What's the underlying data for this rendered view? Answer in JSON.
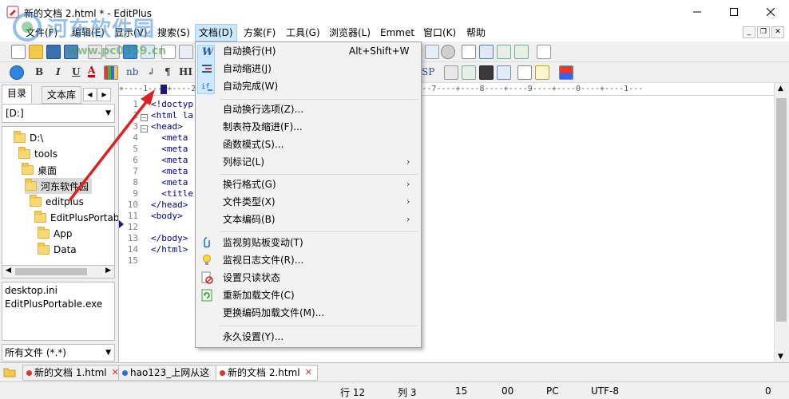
{
  "window": {
    "title": "新的文档 2.html * - EditPlus"
  },
  "menubar": {
    "items": [
      "文件(F)",
      "编辑(E)",
      "显示(V)",
      "搜索(S)",
      "文档(D)",
      "方案(F)",
      "工具(G)",
      "浏览器(L)",
      "Emmet",
      "窗口(K)",
      "帮助"
    ],
    "active": "文档(D)"
  },
  "toolbar2": {
    "bold": "B",
    "italic": "I",
    "underline": "U",
    "color_a": "A",
    "nbsp": "nb",
    "para": "¶",
    "hi": "HI",
    "sp": "SP"
  },
  "sidebar": {
    "tabs": [
      "目录",
      "文本库"
    ],
    "drive": "[D:]",
    "tree": [
      "D:\\",
      "tools",
      "桌面",
      "河东软件园",
      "editplus",
      "EditPlusPortable",
      "App",
      "Data"
    ],
    "selected_tree_item": "河东软件园",
    "files": [
      "desktop.ini",
      "EditPlusPortable.exe"
    ],
    "filter": "所有文件 (*.*)"
  },
  "editor": {
    "ruler": "+----1----+----2----+----3----+----4----+----5----+----6----+----7----+----8----+----9----+----0----+----1---",
    "line_numbers": [
      "1",
      "2",
      "3",
      "4",
      "5",
      "6",
      "7",
      "8",
      "9",
      "10",
      "11",
      "12",
      "13",
      "14",
      "15"
    ],
    "code_lines": [
      "<!doctyp",
      "<html la",
      "<head>",
      "  <meta",
      "  <meta",
      "  <meta",
      "  <meta",
      "  <meta",
      "  <title",
      "</head>",
      "<body>",
      "",
      "</body>",
      "</html>",
      ""
    ],
    "current_line": "12"
  },
  "doc_menu": {
    "items": [
      {
        "label": "自动换行(H)",
        "shortcut": "Alt+Shift+W",
        "icon": "word-wrap-icon"
      },
      {
        "label": "自动缩进(J)",
        "icon": "auto-indent-icon"
      },
      {
        "label": "自动完成(W)",
        "icon": "auto-complete-icon"
      },
      {
        "label": "自动换行选项(Z)...",
        "separator_before": true
      },
      {
        "label": "制表符及缩进(F)..."
      },
      {
        "label": "函数模式(S)..."
      },
      {
        "label": "列标记(L)",
        "submenu": true
      },
      {
        "label": "换行格式(G)",
        "submenu": true,
        "separator_before": true
      },
      {
        "label": "文件类型(X)",
        "submenu": true
      },
      {
        "label": "文本编码(B)",
        "submenu": true
      },
      {
        "label": "监视剪贴板变动(T)",
        "icon": "clipboard-monitor-icon",
        "separator_before": true
      },
      {
        "label": "监视日志文件(R)...",
        "icon": "lightbulb-icon"
      },
      {
        "label": "设置只读状态",
        "icon": "readonly-icon"
      },
      {
        "label": "重新加载文件(C)",
        "icon": "reload-icon"
      },
      {
        "label": "更换编码加载文件(M)..."
      },
      {
        "label": "永久设置(Y)...",
        "separator_before": true
      }
    ]
  },
  "doctabs": [
    {
      "label": "新的文档 1.html",
      "active": false
    },
    {
      "label": "hao123_上网从这",
      "active": false
    },
    {
      "label": "新的文档 2.html",
      "active": true
    }
  ],
  "statusbar": {
    "line": "行 12",
    "col": "列 3",
    "num": "15",
    "hex": "00",
    "os": "PC",
    "encoding": "UTF-8",
    "count": "0"
  },
  "watermark": {
    "text": "河东软件园",
    "url": "www.pc0359.cn"
  },
  "colors": {
    "menu_highlight": "#cce8ff",
    "code_tag": "#000080",
    "arrow_red": "#e02020"
  }
}
